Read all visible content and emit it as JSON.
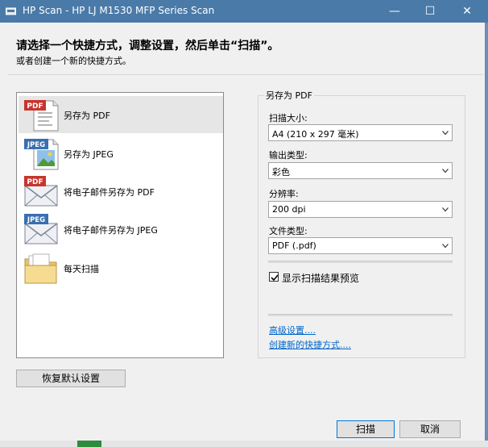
{
  "window": {
    "title": "HP Scan - HP LJ M1530 MFP Series Scan",
    "minimize": "—",
    "maximize": "☐",
    "close": "✕"
  },
  "instructions": {
    "heading": "请选择一个快捷方式，调整设置，然后单击“扫描”。",
    "subheading": "或者创建一个新的快捷方式。"
  },
  "shortcuts": {
    "items": [
      {
        "label": "另存为 PDF",
        "icon": "pdf-document-icon",
        "badge": "PDF",
        "selected": true
      },
      {
        "label": "另存为 JPEG",
        "icon": "jpeg-image-icon",
        "badge": "JPEG",
        "selected": false
      },
      {
        "label": "将电子邮件另存为 PDF",
        "icon": "email-pdf-icon",
        "badge": "PDF",
        "selected": false
      },
      {
        "label": "将电子邮件另存为 JPEG",
        "icon": "email-jpeg-icon",
        "badge": "JPEG",
        "selected": false
      },
      {
        "label": "每天扫描",
        "icon": "folder-icon",
        "selected": false
      }
    ]
  },
  "settings": {
    "group_title": "另存为 PDF",
    "scan_size": {
      "label": "扫描大小:",
      "value": "A4 (210 x 297 毫米)"
    },
    "output_type": {
      "label": "输出类型:",
      "value": "彩色"
    },
    "resolution": {
      "label": "分辨率:",
      "value": "200 dpi"
    },
    "file_type": {
      "label": "文件类型:",
      "value": "PDF (.pdf)"
    },
    "preview": {
      "label": "显示扫描结果预览",
      "checked": true
    },
    "advanced_link": "高级设置....",
    "create_shortcut_link": "创建新的快捷方式...."
  },
  "buttons": {
    "restore_defaults": "恢复默认设置",
    "scan": "扫描",
    "cancel": "取消"
  },
  "colors": {
    "titlebar": "#4a7aa8",
    "link": "#0066cc",
    "pdf_badge": "#c8352c",
    "jpeg_badge": "#3a6fb0"
  }
}
